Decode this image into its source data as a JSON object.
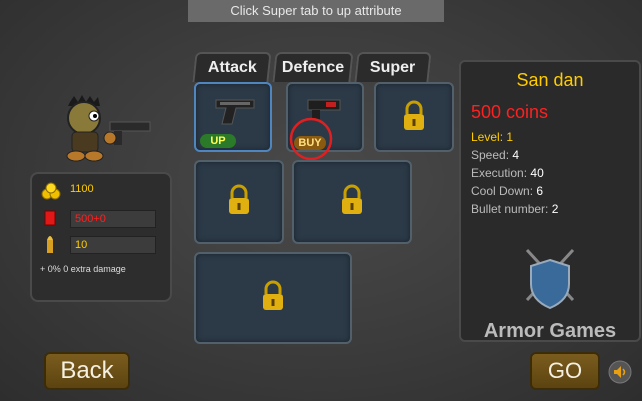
{
  "hint": "Click Super tab to up attribute",
  "tabs": [
    "Attack",
    "Defence",
    "Super"
  ],
  "slots": {
    "slot1_badge": "UP",
    "slot2_badge": "BUY"
  },
  "player_stats": {
    "coins": "1100",
    "health": "500+0",
    "ammo": "10",
    "extra_damage": "+ 0% 0 extra damage"
  },
  "weapon_info": {
    "name": "San dan",
    "price": "500 coins",
    "level_label": "Level:",
    "level_value": "1",
    "speed_label": "Speed:",
    "speed_value": "4",
    "execution_label": "Execution:",
    "execution_value": "40",
    "cooldown_label": "Cool Down:",
    "cooldown_value": "6",
    "bullet_label": "Bullet number:",
    "bullet_value": "2"
  },
  "brand": "Armor Games",
  "buttons": {
    "back": "Back",
    "go": "GO"
  },
  "colors": {
    "coin_red": "#ff2020",
    "gold": "#ffcc00",
    "accent_blue": "#4f86c0"
  }
}
